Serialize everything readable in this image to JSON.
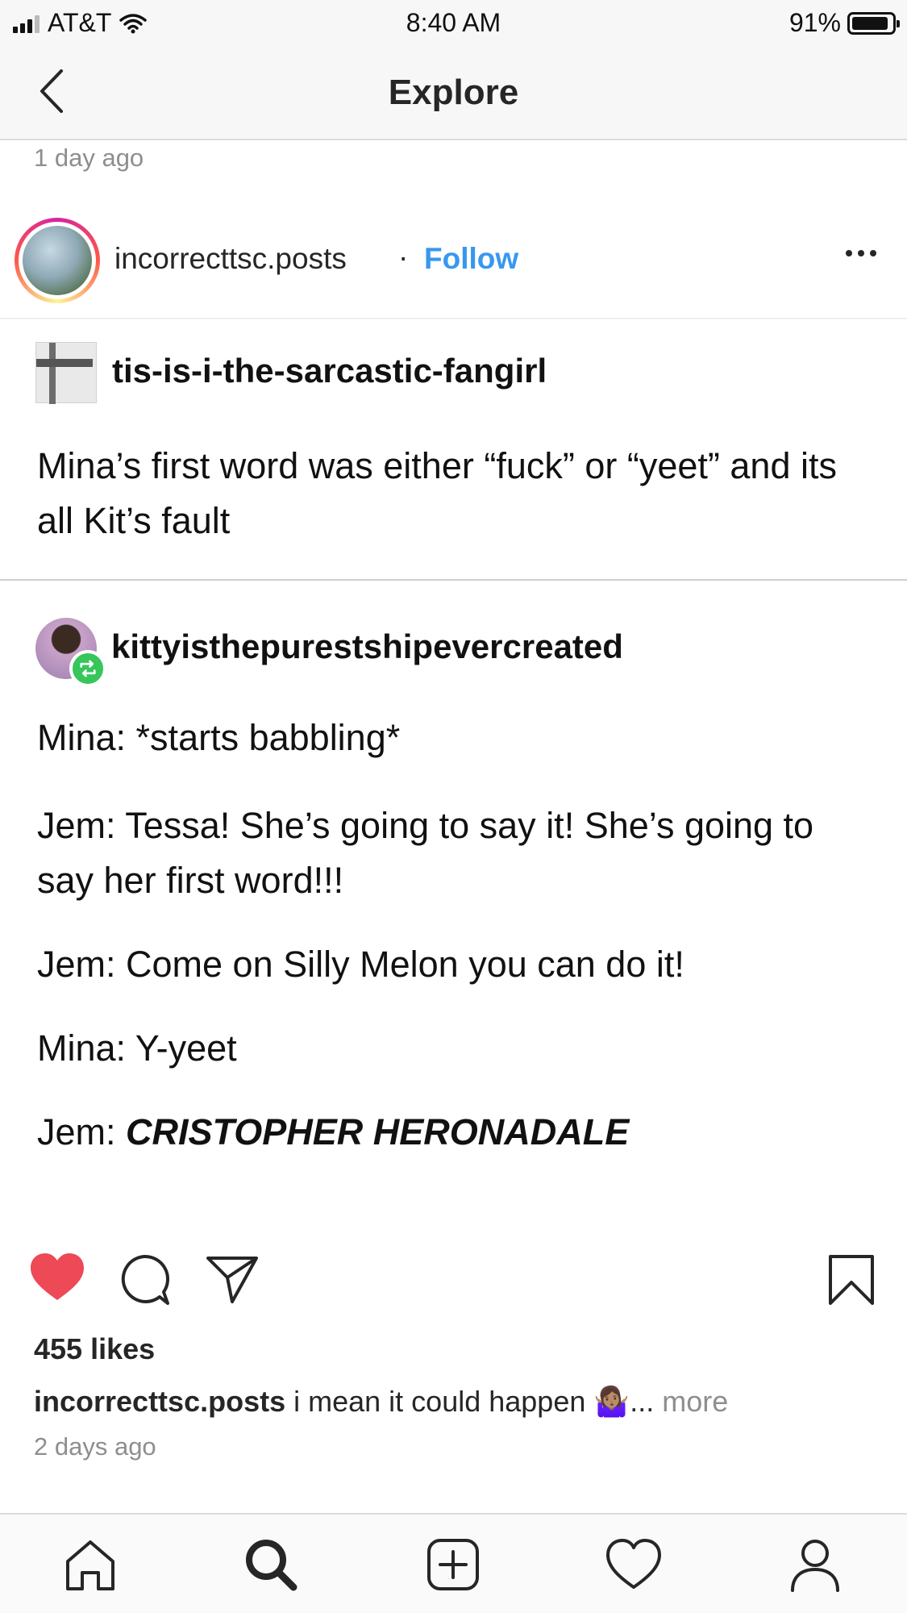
{
  "status_bar": {
    "carrier": "AT&T",
    "time": "8:40 AM",
    "battery": "91%",
    "battery_level": 0.91,
    "icons": [
      "signal-icon",
      "wifi-icon",
      "battery-icon"
    ]
  },
  "nav": {
    "title": "Explore",
    "back_icon": "chevron-left-icon"
  },
  "previous_post_time": "1 day ago",
  "post": {
    "username": "incorrecttsc.posts",
    "separator": "·",
    "follow_label": "Follow",
    "more_icon": "more-horizontal-icon",
    "content": {
      "original_author": "tis-is-i-the-sarcastic-fangirl",
      "original_text": "Mina’s first word was either “fuck” or “yeet” and its all Kit’s fault",
      "reblog_author": "kittyisthepurestshipevercreated",
      "lines": [
        {
          "speaker": "Mina:",
          "text": " *starts babbling*",
          "emphasis": ""
        },
        {
          "speaker": "Jem:",
          "text": " Tessa! She’s going to say it! She’s going to say her first word!!!",
          "emphasis": ""
        },
        {
          "speaker": "Jem:",
          "text": " Come on Silly Melon you can do it!",
          "emphasis": ""
        },
        {
          "speaker": "Mina:",
          "text": " Y-yeet",
          "emphasis": ""
        },
        {
          "speaker": "Jem: ",
          "text": "",
          "emphasis": "CRISTOPHER HERONADALE"
        }
      ]
    },
    "actions": {
      "liked": true,
      "icons": [
        "heart-filled-icon",
        "comment-icon",
        "share-icon",
        "bookmark-icon"
      ]
    },
    "likes": "455 likes",
    "caption_user": "incorrecttsc.posts",
    "caption_text": "i mean it could happen 🤷🏽‍♀️...",
    "caption_more": "more",
    "time": "2 days ago"
  },
  "tab_bar": {
    "tabs": [
      "home-icon",
      "search-icon",
      "add-post-icon",
      "activity-heart-icon",
      "profile-icon"
    ]
  },
  "colors": {
    "accent": "#3897f0",
    "heart": "#ed4956",
    "reblog": "#36c65a",
    "text": "#262626",
    "muted": "#8e8e8e"
  }
}
